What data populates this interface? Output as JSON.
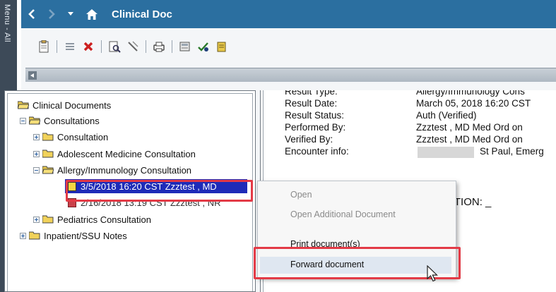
{
  "side_menu": {
    "label": "Menu - All"
  },
  "header": {
    "back_icon": "chevron-left",
    "forward_icon": "chevron-right",
    "dropdown_icon": "caret-down",
    "home_icon": "home",
    "title": "Clinical Doc"
  },
  "toolbar": {
    "icons": [
      "new-document-icon",
      "list-icon",
      "delete-icon",
      "view-icon",
      "edit-icon",
      "print-icon",
      "forward-icon",
      "sign-icon",
      "reminder-icon"
    ]
  },
  "tree": {
    "root": "Clinical Documents",
    "consultations": "Consultations",
    "consultation": "Consultation",
    "adolescent": "Adolescent Medicine Consultation",
    "allergy": "Allergy/Immunology Consultation",
    "doc_selected": "3/5/2018 16:20 CST Zzztest , MD",
    "doc_second": "2/16/2018 13:19 CST Zzztest , NR",
    "pediatrics": "Pediatrics Consultation",
    "inpatient": "Inpatient/SSU Notes"
  },
  "details": {
    "rows": [
      {
        "label": "Result Type:",
        "value": "Allergy/Immunology Cons"
      },
      {
        "label": "Result Date:",
        "value": "March 05, 2018 16:20 CST"
      },
      {
        "label": "Result Status:",
        "value": "Auth (Verified)"
      },
      {
        "label": "Performed By:",
        "value": "Zzztest , MD Med Ord on"
      },
      {
        "label": "Verified By:",
        "value": "Zzztest , MD Med Ord on"
      },
      {
        "label": "Encounter info:",
        "value": "St Paul, Emerg"
      }
    ],
    "section_fragment": "ATION: _"
  },
  "context_menu": {
    "open": "Open",
    "open_additional": "Open Additional Document",
    "print": "Print document(s)",
    "forward": "Forward document"
  },
  "colors": {
    "header_bg": "#2b6fa0",
    "selection_bg": "#1e2bb8",
    "highlight_border": "#e33a46"
  }
}
